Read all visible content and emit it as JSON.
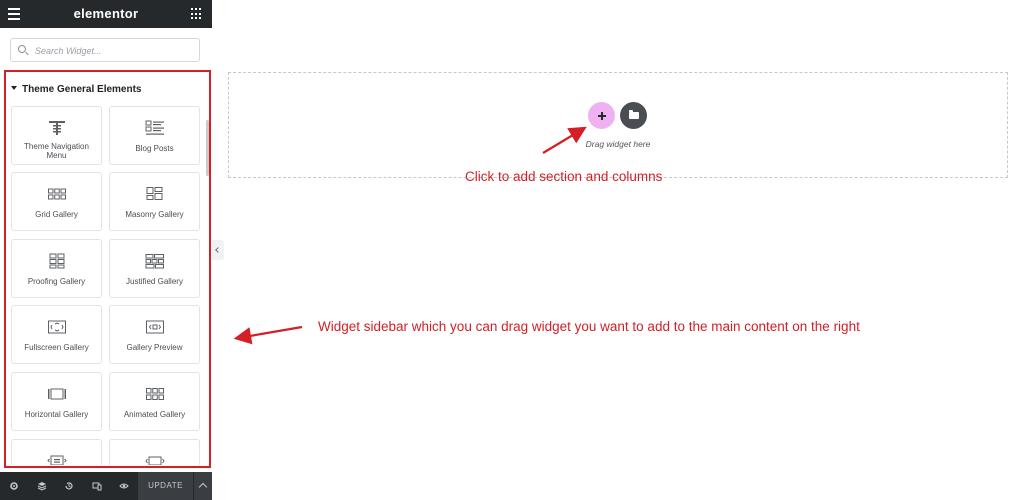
{
  "app": {
    "logo": "elementor"
  },
  "search": {
    "placeholder": "Search Widget..."
  },
  "panel": {
    "category": "Theme General Elements",
    "widgets": [
      {
        "label": "Theme Navigation Menu",
        "icon": "navigation-menu-icon"
      },
      {
        "label": "Blog Posts",
        "icon": "blog-posts-icon"
      },
      {
        "label": "Grid Gallery",
        "icon": "grid-gallery-icon"
      },
      {
        "label": "Masonry Gallery",
        "icon": "masonry-gallery-icon"
      },
      {
        "label": "Proofing Gallery",
        "icon": "proofing-gallery-icon"
      },
      {
        "label": "Justified Gallery",
        "icon": "justified-gallery-icon"
      },
      {
        "label": "Fullscreen Gallery",
        "icon": "fullscreen-gallery-icon"
      },
      {
        "label": "Gallery Preview",
        "icon": "gallery-preview-icon"
      },
      {
        "label": "Horizontal Gallery",
        "icon": "horizontal-gallery-icon"
      },
      {
        "label": "Animated Gallery",
        "icon": "animated-gallery-icon"
      },
      {
        "label": "",
        "icon": "slider-icon"
      },
      {
        "label": "",
        "icon": "carousel-icon"
      }
    ]
  },
  "footer": {
    "update_label": "UPDATE",
    "icons": [
      "settings-icon",
      "layers-icon",
      "history-icon",
      "responsive-icon",
      "preview-icon"
    ]
  },
  "canvas": {
    "drag_text": "Drag widget here"
  },
  "annotations": {
    "add_section": "Click to add section and columns",
    "sidebar": "Widget sidebar which you can drag widget you want to add to the main content on the right"
  },
  "colors": {
    "annotation": "#d31f25",
    "add_button": "#f0b1f3",
    "dark": "#26292c"
  }
}
